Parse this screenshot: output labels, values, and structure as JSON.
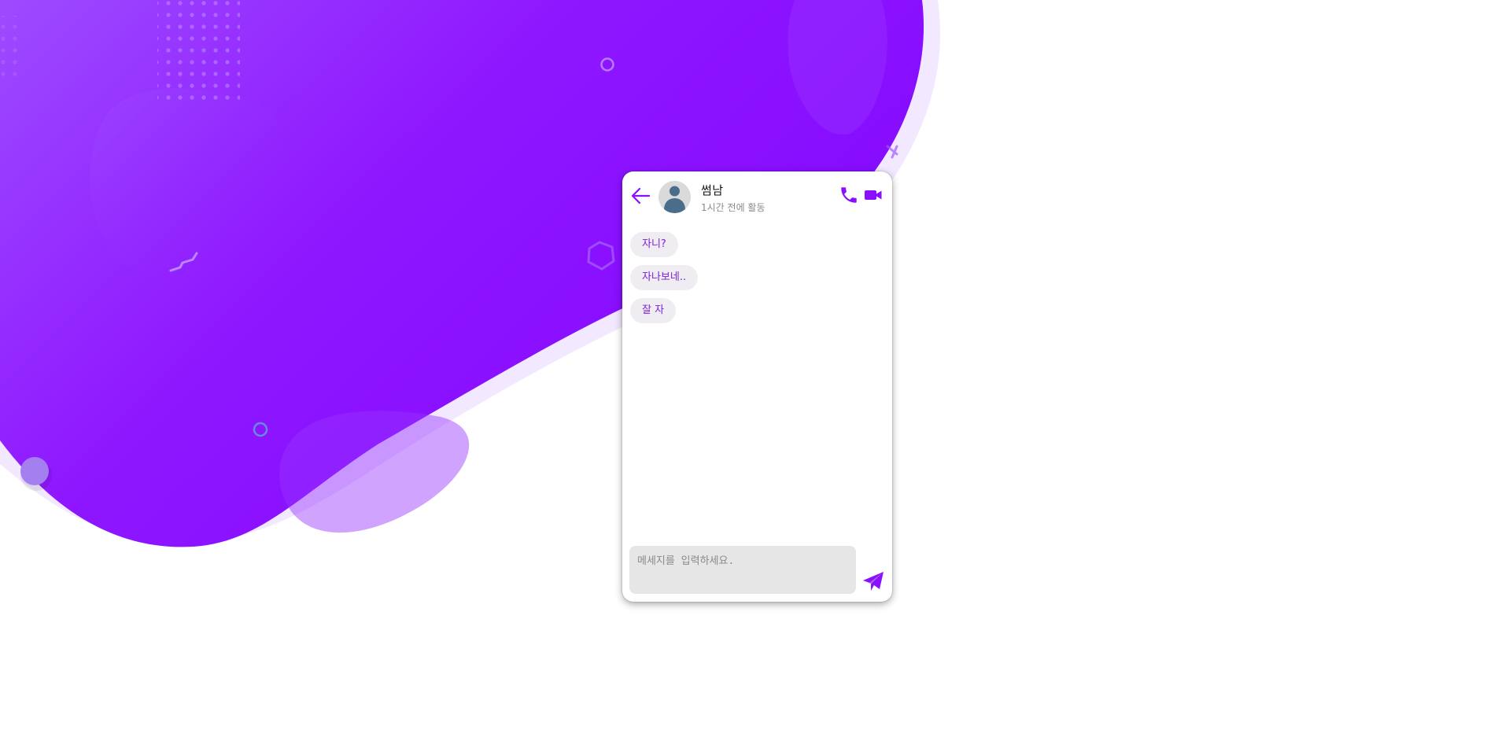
{
  "colors": {
    "accent": "#8a0fff",
    "bubble_bg": "#efedf2",
    "bubble_text": "#7b1fd6",
    "input_bg": "#e6e6e6"
  },
  "chat": {
    "back_icon": "arrow-left-icon",
    "avatar_icon": "person-avatar-icon",
    "contact": {
      "name": "썸남",
      "status": "1시간 전에 활동"
    },
    "actions": {
      "call_icon": "phone-icon",
      "video_icon": "video-camera-icon"
    },
    "messages": [
      {
        "text": "자니?"
      },
      {
        "text": "자나보네.."
      },
      {
        "text": "잘 자"
      }
    ],
    "composer": {
      "placeholder": "메세지를 입력하세요.",
      "value": "",
      "send_icon": "paper-plane-send-icon"
    }
  }
}
